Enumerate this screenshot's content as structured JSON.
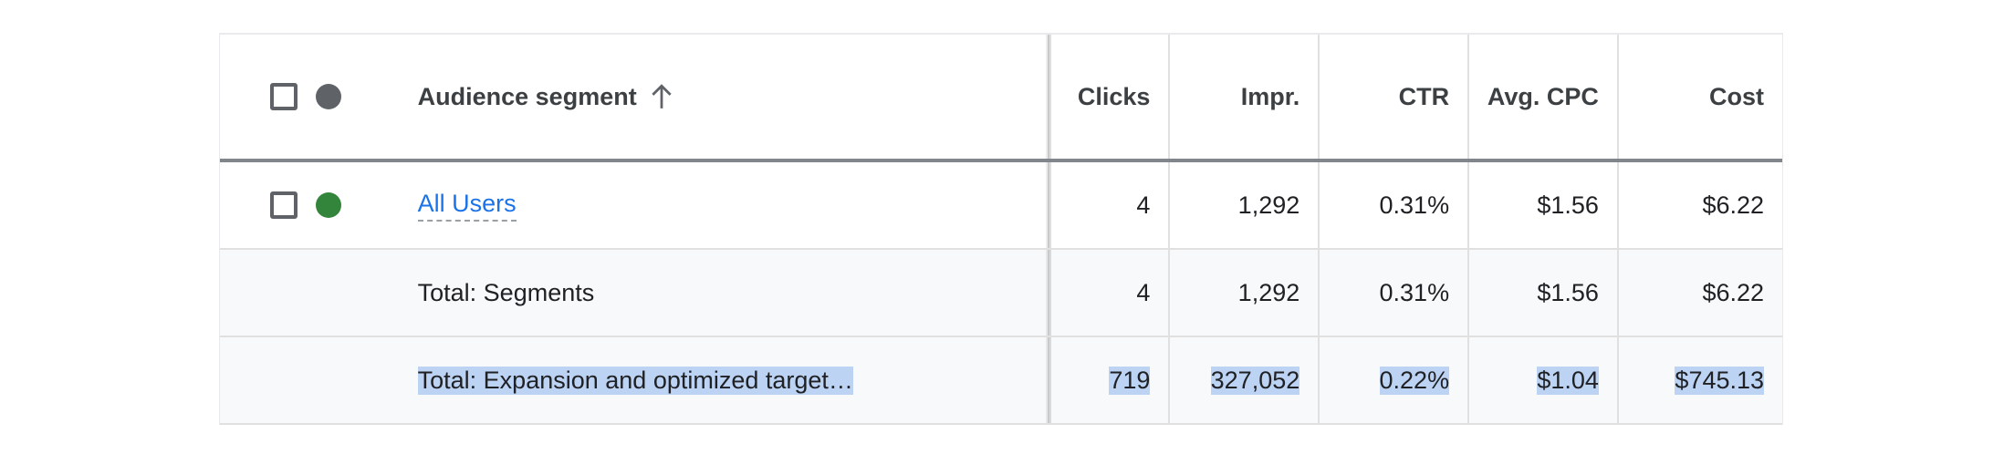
{
  "colors": {
    "header_dot": "#5f6368",
    "status_enabled": "#34853c",
    "link": "#1a73e8",
    "selection_highlight": "#bcd3f4",
    "total_row_bg": "#f8f9fa"
  },
  "header": {
    "segment_label": "Audience segment",
    "sort_icon": "arrow-up-icon",
    "columns": {
      "clicks": "Clicks",
      "impr": "Impr.",
      "ctr": "CTR",
      "cpc": "Avg. CPC",
      "cost": "Cost"
    }
  },
  "rows": [
    {
      "segment": "All Users",
      "clicks": "4",
      "impr": "1,292",
      "ctr": "0.31%",
      "cpc": "$1.56",
      "cost": "$6.22"
    }
  ],
  "totals": [
    {
      "segment": "Total: Segments",
      "clicks": "4",
      "impr": "1,292",
      "ctr": "0.31%",
      "cpc": "$1.56",
      "cost": "$6.22"
    },
    {
      "segment": "Total: Expansion and optimized target…",
      "clicks": "719",
      "impr": "327,052",
      "ctr": "0.22%",
      "cpc": "$1.04",
      "cost": "$745.13"
    }
  ]
}
